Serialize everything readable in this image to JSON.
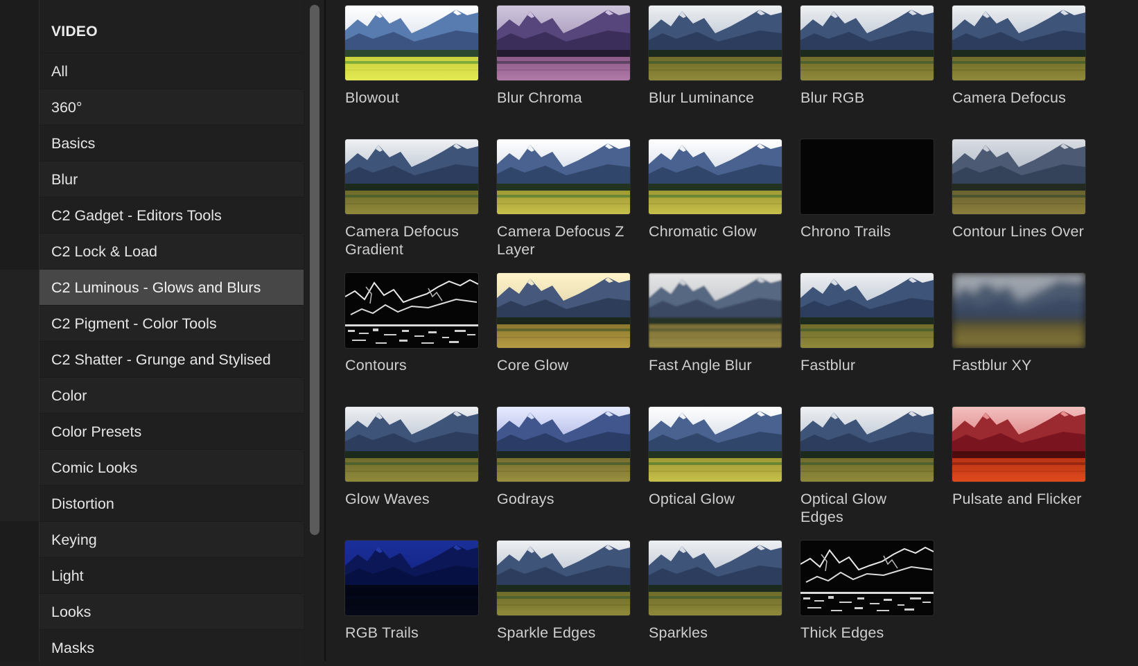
{
  "sidebar": {
    "heading": "VIDEO",
    "items": [
      {
        "label": "All"
      },
      {
        "label": "360°"
      },
      {
        "label": "Basics"
      },
      {
        "label": "Blur"
      },
      {
        "label": "C2 Gadget - Editors Tools"
      },
      {
        "label": "C2 Lock & Load"
      },
      {
        "label": "C2 Luminous - Glows and Blurs",
        "selected": true
      },
      {
        "label": "C2 Pigment - Color Tools"
      },
      {
        "label": "C2 Shatter - Grunge and Stylised"
      },
      {
        "label": "Color"
      },
      {
        "label": "Color Presets"
      },
      {
        "label": "Comic Looks"
      },
      {
        "label": "Distortion"
      },
      {
        "label": "Keying"
      },
      {
        "label": "Light"
      },
      {
        "label": "Looks"
      },
      {
        "label": "Masks"
      }
    ]
  },
  "effects": [
    {
      "label": "Blowout",
      "style": "blowout"
    },
    {
      "label": "Blur Chroma",
      "style": "chroma"
    },
    {
      "label": "Blur Luminance",
      "style": "normal"
    },
    {
      "label": "Blur RGB",
      "style": "normal"
    },
    {
      "label": "Camera Defocus",
      "style": "normal"
    },
    {
      "label": "Camera Defocus Gradient",
      "style": "normal"
    },
    {
      "label": "Camera Defocus Z Layer",
      "style": "bright"
    },
    {
      "label": "Chromatic Glow",
      "style": "bright"
    },
    {
      "label": "Chrono Trails",
      "style": "black"
    },
    {
      "label": "Contour Lines Over",
      "style": "muted"
    },
    {
      "label": "Contours",
      "style": "contours"
    },
    {
      "label": "Core Glow",
      "style": "warm"
    },
    {
      "label": "Fast Angle Blur",
      "style": "soft"
    },
    {
      "label": "Fastblur",
      "style": "normal"
    },
    {
      "label": "Fastblur XY",
      "style": "heavyblur"
    },
    {
      "label": "Glow Waves",
      "style": "normal"
    },
    {
      "label": "Godrays",
      "style": "cool"
    },
    {
      "label": "Optical Glow",
      "style": "bright"
    },
    {
      "label": "Optical Glow Edges",
      "style": "normal"
    },
    {
      "label": "Pulsate and Flicker",
      "style": "red"
    },
    {
      "label": "RGB Trails",
      "style": "blue"
    },
    {
      "label": "Sparkle Edges",
      "style": "normal"
    },
    {
      "label": "Sparkles",
      "style": "normal"
    },
    {
      "label": "Thick Edges",
      "style": "contours"
    }
  ]
}
